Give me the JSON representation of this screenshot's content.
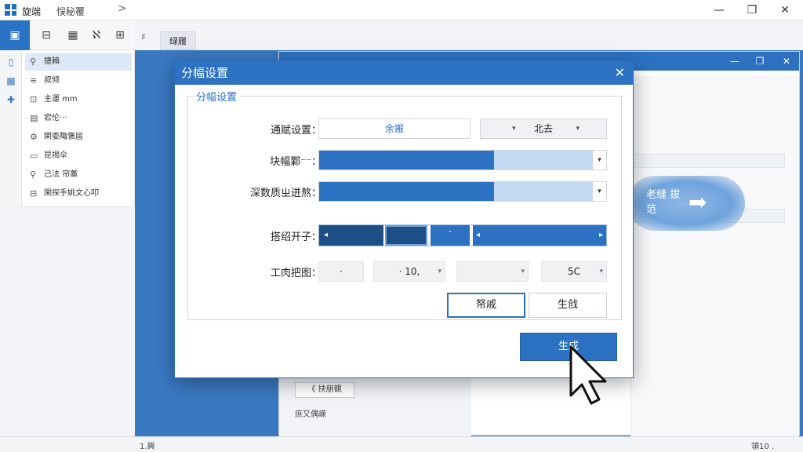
{
  "app": {
    "name": "旋端",
    "subname": "悮秘覆",
    "chevron": ">",
    "window_controls": [
      "—",
      "❐",
      "✕"
    ]
  },
  "ribbon": {
    "buttons": [
      "▣",
      "⊟",
      "▦",
      "ℵ",
      "⊞"
    ]
  },
  "nav": {
    "items": [
      {
        "icon": "⚲",
        "label": "捷賴",
        "selected": true
      },
      {
        "icon": "≡",
        "label": "叔倾",
        "selected": false
      },
      {
        "icon": "⊡",
        "label": "主運 mm",
        "selected": false
      },
      {
        "icon": "▤",
        "label": "宕伦···",
        "selected": false
      },
      {
        "icon": "⚙",
        "label": "閑委陬褒屆",
        "selected": false
      },
      {
        "icon": "▭",
        "label": "昆揭伞",
        "selected": false
      },
      {
        "icon": "⚲",
        "label": "己法 帘藁",
        "selected": false
      },
      {
        "icon": "⊟",
        "label": "閑探手姚文心叩",
        "selected": false
      }
    ]
  },
  "doc": {
    "tab_label": "绿履",
    "tab_icon": "♯"
  },
  "bg_window": {
    "controls": [
      "—",
      "❐",
      "✕"
    ],
    "lower_button": "《 扶朋覩",
    "lower_text": "庶又偶嵘"
  },
  "statusbar": {
    "left": "1.興",
    "right": "領10 ."
  },
  "hint": {
    "text": "老缝 拔范",
    "arrow": "➡"
  },
  "dialog": {
    "title": "分幅设置",
    "close": "✕",
    "group_title": "分幅设置",
    "rows": {
      "general": {
        "label": "通赋设置：",
        "value": "余搬",
        "dropdown": "北去",
        "dropdown_caret": "▾"
      },
      "block": {
        "label": "块幅鄴⁻⁻：",
        "fill": 0.61,
        "caret": "▾"
      },
      "depth": {
        "label": "深数质ㄓ迸熬：",
        "fill": 0.61,
        "caret": "▾"
      },
      "opener": {
        "label": "搭绍开子：",
        "seg_left": "◂",
        "seg_mid": "ˇ",
        "seg_right": "▸"
      },
      "chart": {
        "label": "工肉把图：",
        "values": [
          "·",
          "· 10,",
          "",
          "5C"
        ],
        "caret": "▾"
      }
    },
    "buttons": {
      "cancel": "帑戚",
      "generate_small": "生戗",
      "generate": "生戍"
    }
  },
  "colors": {
    "accent": "#2d72c2",
    "workspace": "#3a78c2",
    "bar_track": "#c3d9f1"
  }
}
